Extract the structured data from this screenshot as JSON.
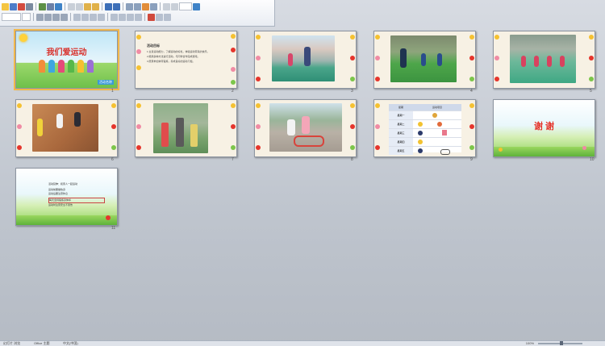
{
  "slides": [
    {
      "number": "1",
      "title": "我们爱运动",
      "label": "活动名称"
    },
    {
      "number": "2",
      "heading": "活动目标",
      "lines": [
        "1.全身运动能力，了解运动的好处，体验运动带来的快乐。",
        "2.能用多种方法进行活动，与同伴合作完成游戏。",
        "3.愿意参加体育锻炼，养成良好的运动习惯。"
      ]
    },
    {
      "number": "3"
    },
    {
      "number": "4"
    },
    {
      "number": "5"
    },
    {
      "number": "6"
    },
    {
      "number": "7"
    },
    {
      "number": "8"
    },
    {
      "number": "9",
      "table_header": [
        "星期",
        "运动项目"
      ],
      "table_rows": [
        "星期一",
        "星期二",
        "星期三",
        "星期四",
        "星期五"
      ]
    },
    {
      "number": "10",
      "title": "谢 谢"
    },
    {
      "number": "11",
      "lines": [
        "活动延伸：和家人一起运动",
        "运动前要做热身",
        "运动后要注意休息",
        "每天坚持锻炼身体棒",
        "运动时注意安全不受伤"
      ]
    }
  ],
  "status": {
    "slide_info": "幻灯片 浏览",
    "theme": "Office 主题",
    "language": "中文(中国)",
    "zoom": "100%"
  },
  "colors": {
    "accent_red": "#e5352c",
    "title_red": "#d9312b",
    "grass": "#7cc64a"
  }
}
